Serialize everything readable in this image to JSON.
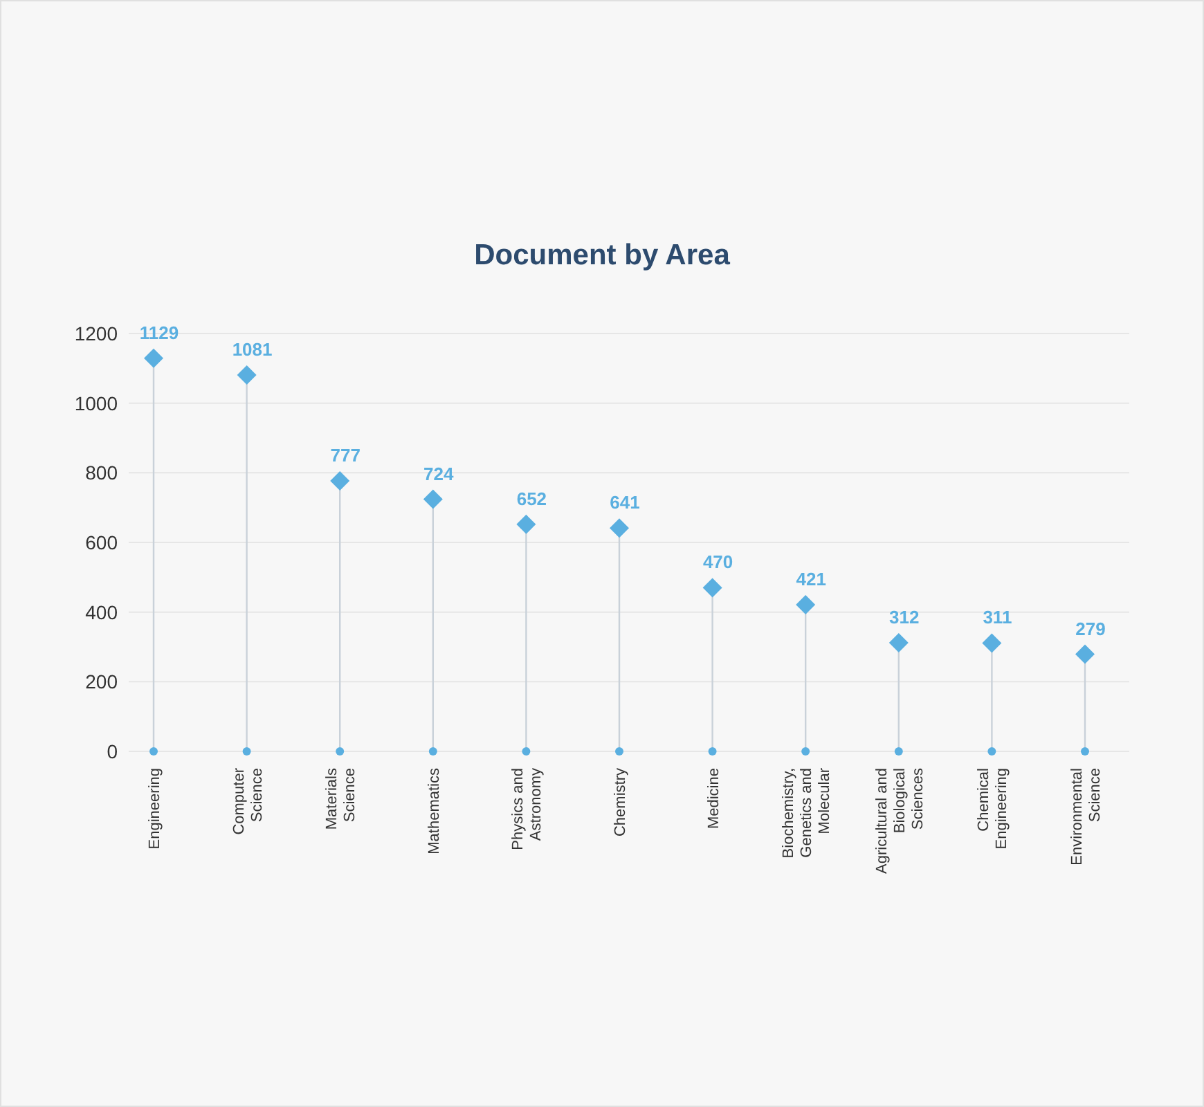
{
  "chart": {
    "chart_data": {
      "type": "scatter",
      "title": "Document by Area",
      "categories": [
        "Engineering",
        "Computer\nScience",
        "Materials\nScience",
        "Mathematics",
        "Physics and\nAstronomy",
        "Chemistry",
        "Medicine",
        "Biochemistry,\nGenetics and\nMolecular",
        "Agricultural and\nBiological\nSciences",
        "Chemical\nEngineering",
        "Environmental\nScience"
      ],
      "values": [
        1129,
        1081,
        777,
        724,
        652,
        641,
        470,
        421,
        312,
        311,
        279
      ],
      "ylim": [
        0,
        1200
      ],
      "yticks": [
        0,
        200,
        400,
        600,
        800,
        1000,
        1200
      ],
      "data_labels": true,
      "grid": true
    }
  }
}
